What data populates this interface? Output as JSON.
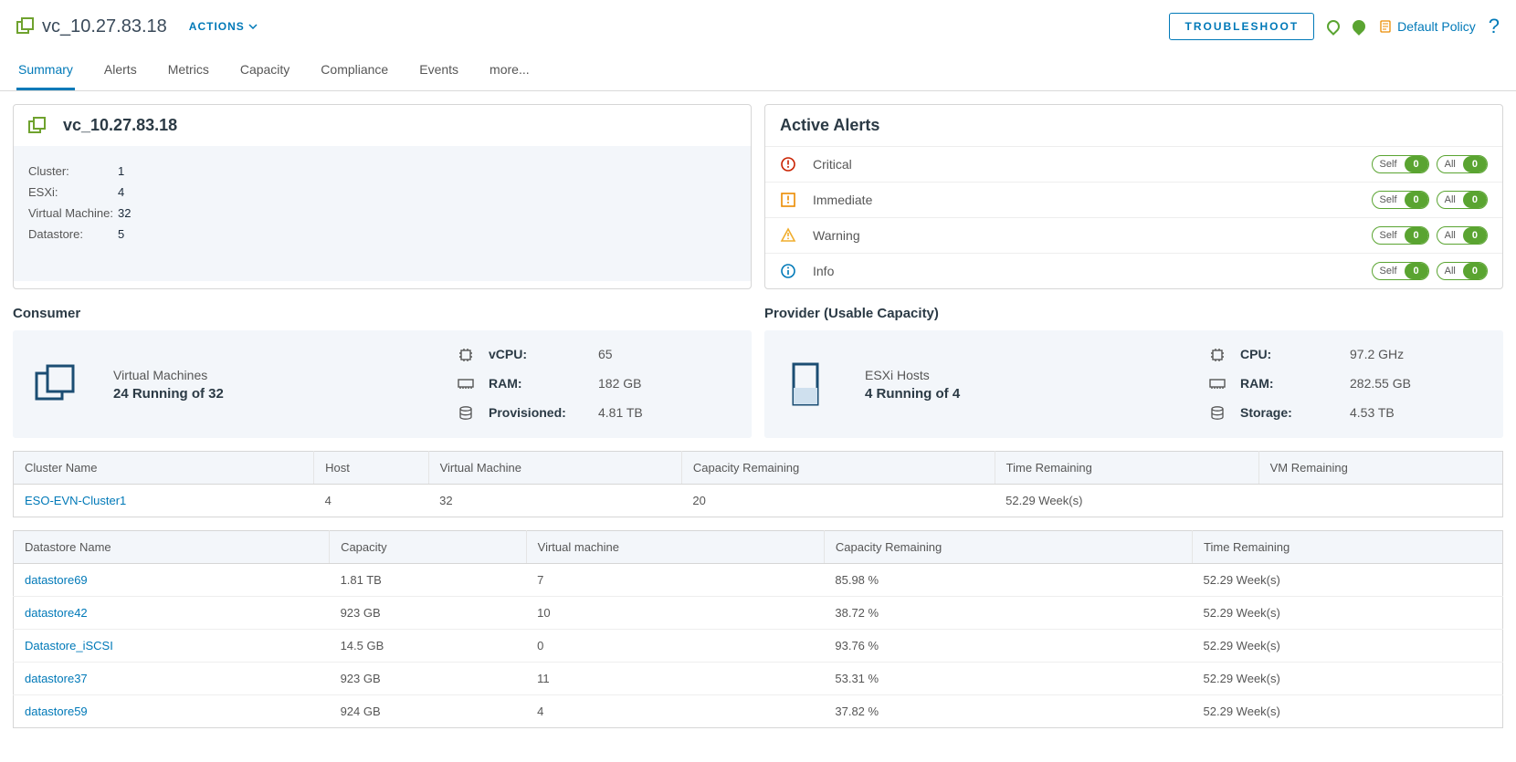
{
  "header": {
    "title": "vc_10.27.83.18",
    "actions_label": "ACTIONS",
    "troubleshoot_label": "TROUBLESHOOT",
    "policy_label": "Default Policy"
  },
  "tabs": [
    "Summary",
    "Alerts",
    "Metrics",
    "Capacity",
    "Compliance",
    "Events",
    "more..."
  ],
  "summary_card": {
    "title": "vc_10.27.83.18",
    "stats": [
      {
        "label": "Cluster:",
        "value": "1"
      },
      {
        "label": "ESXi:",
        "value": "4"
      },
      {
        "label": "Virtual Machine:",
        "value": "32"
      },
      {
        "label": "Datastore:",
        "value": "5"
      }
    ]
  },
  "alerts_card": {
    "title": "Active Alerts",
    "rows": [
      {
        "label": "Critical",
        "self": "0",
        "all": "0",
        "color": "#c92100",
        "shape": "bang-circle"
      },
      {
        "label": "Immediate",
        "self": "0",
        "all": "0",
        "color": "#eb8b00",
        "shape": "bang-square"
      },
      {
        "label": "Warning",
        "self": "0",
        "all": "0",
        "color": "#f0ad2d",
        "shape": "bang-tri"
      },
      {
        "label": "Info",
        "self": "0",
        "all": "0",
        "color": "#0079b8",
        "shape": "info-circle"
      }
    ],
    "self_label": "Self",
    "all_label": "All"
  },
  "consumer": {
    "title": "Consumer",
    "vm_label": "Virtual Machines",
    "vm_status": "24 Running of 32",
    "metrics": [
      {
        "label": "vCPU:",
        "value": "65",
        "icon": "cpu"
      },
      {
        "label": "RAM:",
        "value": "182 GB",
        "icon": "ram"
      },
      {
        "label": "Provisioned:",
        "value": "4.81 TB",
        "icon": "storage"
      }
    ]
  },
  "provider": {
    "title": "Provider (Usable Capacity)",
    "host_label": "ESXi Hosts",
    "host_status": "4 Running of 4",
    "metrics": [
      {
        "label": "CPU:",
        "value": "97.2 GHz",
        "icon": "cpu"
      },
      {
        "label": "RAM:",
        "value": "282.55 GB",
        "icon": "ram"
      },
      {
        "label": "Storage:",
        "value": "4.53 TB",
        "icon": "storage"
      }
    ]
  },
  "cluster_table": {
    "headers": [
      "Cluster Name",
      "Host",
      "Virtual Machine",
      "Capacity Remaining",
      "Time Remaining",
      "VM Remaining"
    ],
    "rows": [
      {
        "name": "ESO-EVN-Cluster1",
        "host": "4",
        "vm": "32",
        "cap": "20",
        "time": "52.29 Week(s)",
        "vmr": ""
      }
    ]
  },
  "datastore_table": {
    "headers": [
      "Datastore Name",
      "Capacity",
      "Virtual machine",
      "Capacity Remaining",
      "Time Remaining"
    ],
    "rows": [
      {
        "name": "datastore69",
        "cap": "1.81 TB",
        "vm": "7",
        "capr": "85.98 %",
        "time": "52.29 Week(s)"
      },
      {
        "name": "datastore42",
        "cap": "923 GB",
        "vm": "10",
        "capr": "38.72 %",
        "time": "52.29 Week(s)"
      },
      {
        "name": "Datastore_iSCSI",
        "cap": "14.5 GB",
        "vm": "0",
        "capr": "93.76 %",
        "time": "52.29 Week(s)"
      },
      {
        "name": "datastore37",
        "cap": "923 GB",
        "vm": "11",
        "capr": "53.31 %",
        "time": "52.29 Week(s)"
      },
      {
        "name": "datastore59",
        "cap": "924 GB",
        "vm": "4",
        "capr": "37.82 %",
        "time": "52.29 Week(s)"
      }
    ]
  }
}
